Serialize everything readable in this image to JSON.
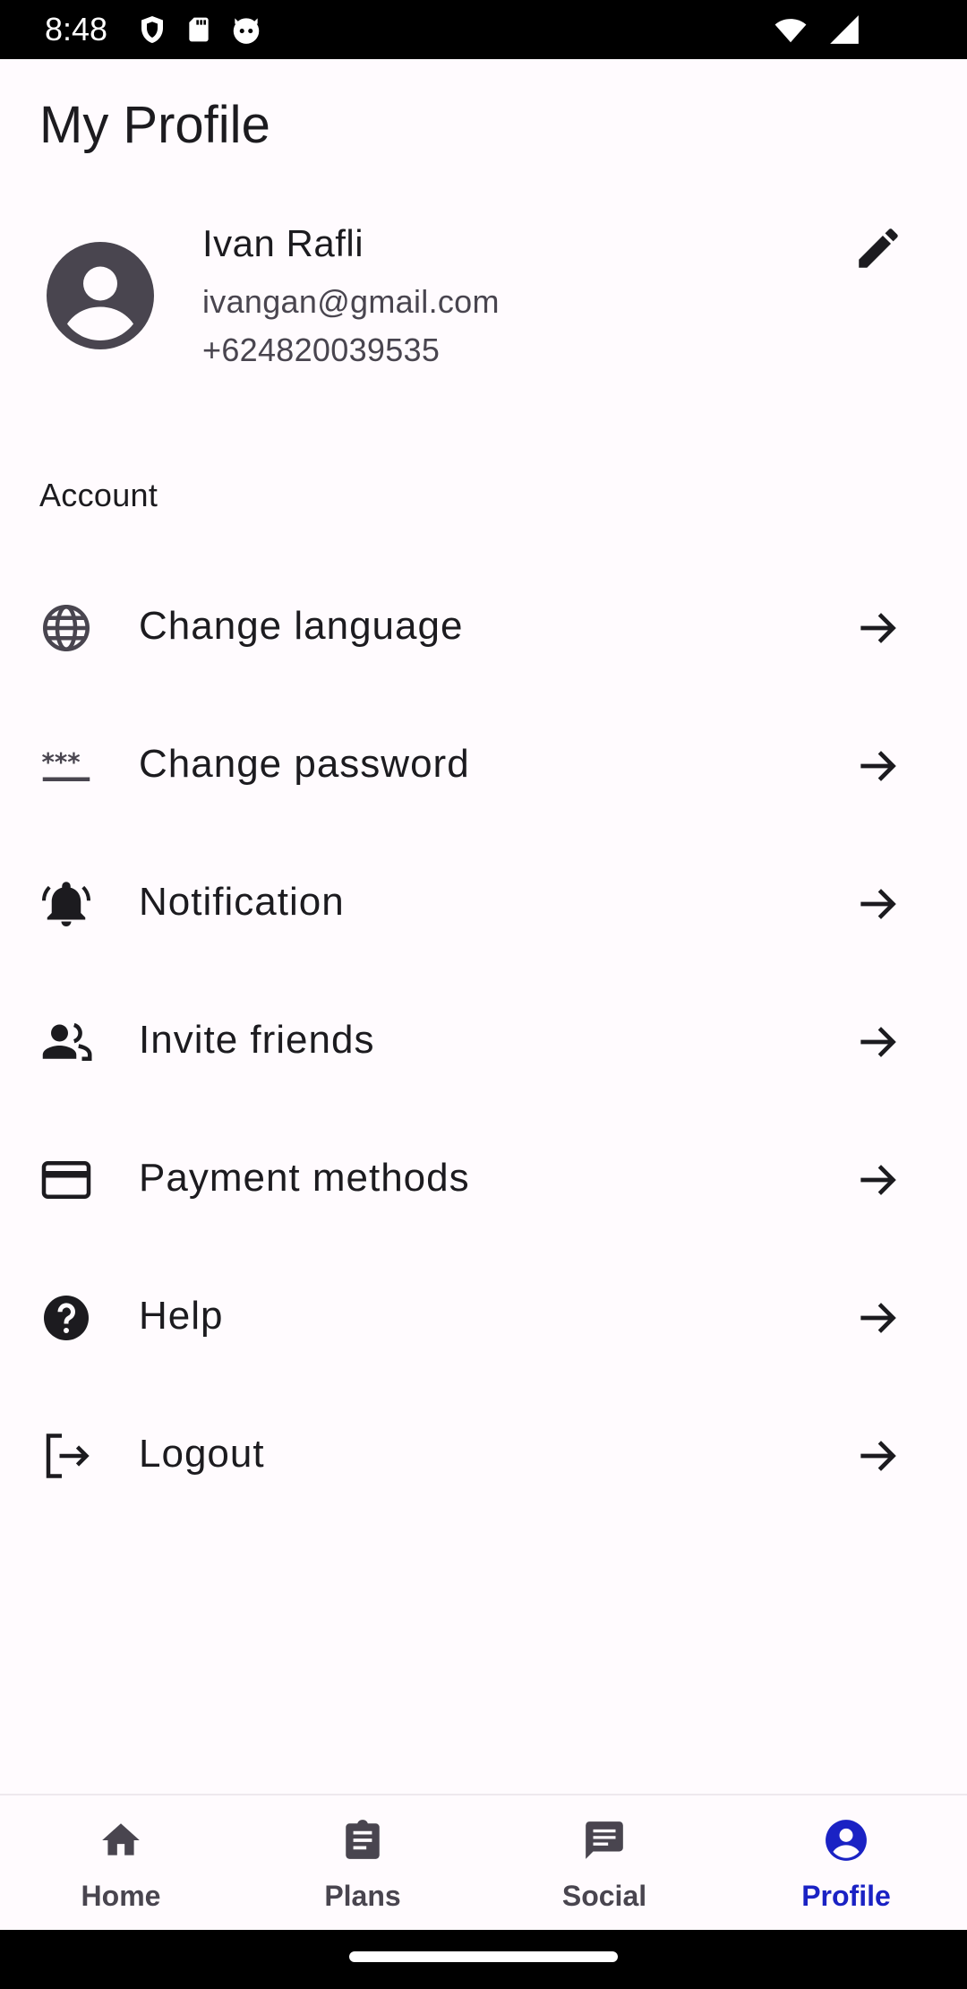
{
  "status_bar": {
    "time": "8:48",
    "icons_left": [
      "shield-icon",
      "sd-card-icon",
      "cat-face-icon"
    ],
    "icons_right": [
      "wifi-icon",
      "signal-icon"
    ]
  },
  "page": {
    "title": "My Profile"
  },
  "profile": {
    "name": "Ivan Rafli",
    "email": "ivangan@gmail.com",
    "phone": "+624820039535",
    "avatar_icon": "account-circle-icon",
    "edit_icon": "pencil-icon"
  },
  "section": {
    "label": "Account"
  },
  "menu": {
    "items": [
      {
        "label": "Change language",
        "icon": "globe-icon"
      },
      {
        "label": "Change password",
        "icon": "password-icon"
      },
      {
        "label": "Notification",
        "icon": "bell-icon"
      },
      {
        "label": "Invite friends",
        "icon": "people-icon"
      },
      {
        "label": "Payment methods",
        "icon": "credit-card-icon"
      },
      {
        "label": "Help",
        "icon": "help-icon"
      },
      {
        "label": "Logout",
        "icon": "logout-icon"
      }
    ],
    "arrow_icon": "arrow-right-icon"
  },
  "bottom_nav": {
    "items": [
      {
        "label": "Home",
        "icon": "home-icon"
      },
      {
        "label": "Plans",
        "icon": "clipboard-icon"
      },
      {
        "label": "Social",
        "icon": "chat-icon"
      },
      {
        "label": "Profile",
        "icon": "person-icon"
      }
    ],
    "active": "Profile"
  },
  "colors": {
    "background": "#fffbfe",
    "text_primary": "#1c1b1f",
    "text_secondary": "#49454f",
    "accent": "#1a22c4",
    "icon": "#49454f"
  }
}
